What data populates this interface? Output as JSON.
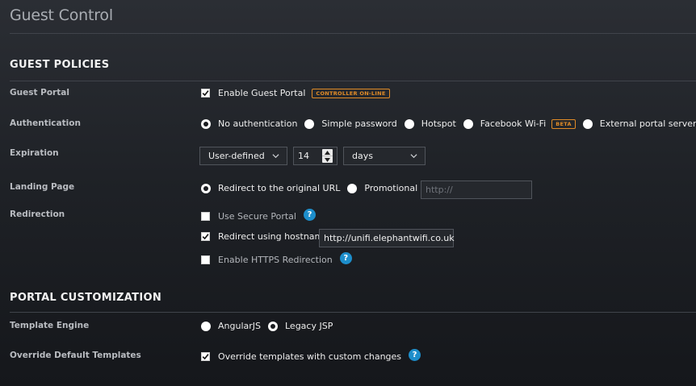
{
  "page": {
    "title": "Guest Control"
  },
  "guest_policies": {
    "title": "GUEST POLICIES",
    "guest_portal": {
      "label": "Guest Portal",
      "enable_label": "Enable Guest Portal",
      "enabled": true,
      "status_badge": "CONTROLLER ON-LINE"
    },
    "authentication": {
      "label": "Authentication",
      "options": [
        "No authentication",
        "Simple password",
        "Hotspot",
        "Facebook Wi-Fi",
        "External portal server"
      ],
      "selected": "No authentication",
      "beta_badge": "BETA"
    },
    "expiration": {
      "label": "Expiration",
      "mode": "User-defined",
      "amount": "14",
      "unit": "days"
    },
    "landing_page": {
      "label": "Landing Page",
      "options": [
        "Redirect to the original URL",
        "Promotional URL"
      ],
      "selected": "Redirect to the original URL",
      "url_placeholder": "http://"
    },
    "redirection": {
      "label": "Redirection",
      "secure_portal_label": "Use Secure Portal",
      "secure_portal": false,
      "hostname_label": "Redirect using hostname",
      "hostname_enabled": true,
      "hostname_value": "http://unifi.elephantwifi.co.uk",
      "https_label": "Enable HTTPS Redirection",
      "https": false
    }
  },
  "portal_customization": {
    "title": "PORTAL CUSTOMIZATION",
    "template_engine": {
      "label": "Template Engine",
      "options": [
        "AngularJS",
        "Legacy JSP"
      ],
      "selected": "Legacy JSP"
    },
    "override_templates": {
      "label": "Override Default Templates",
      "checkbox_label": "Override templates with custom changes",
      "checked": true
    }
  },
  "help_glyph": "?",
  "colors": {
    "badge": "#e08b27",
    "help": "#1d8ecb",
    "background": "#1f2227"
  }
}
